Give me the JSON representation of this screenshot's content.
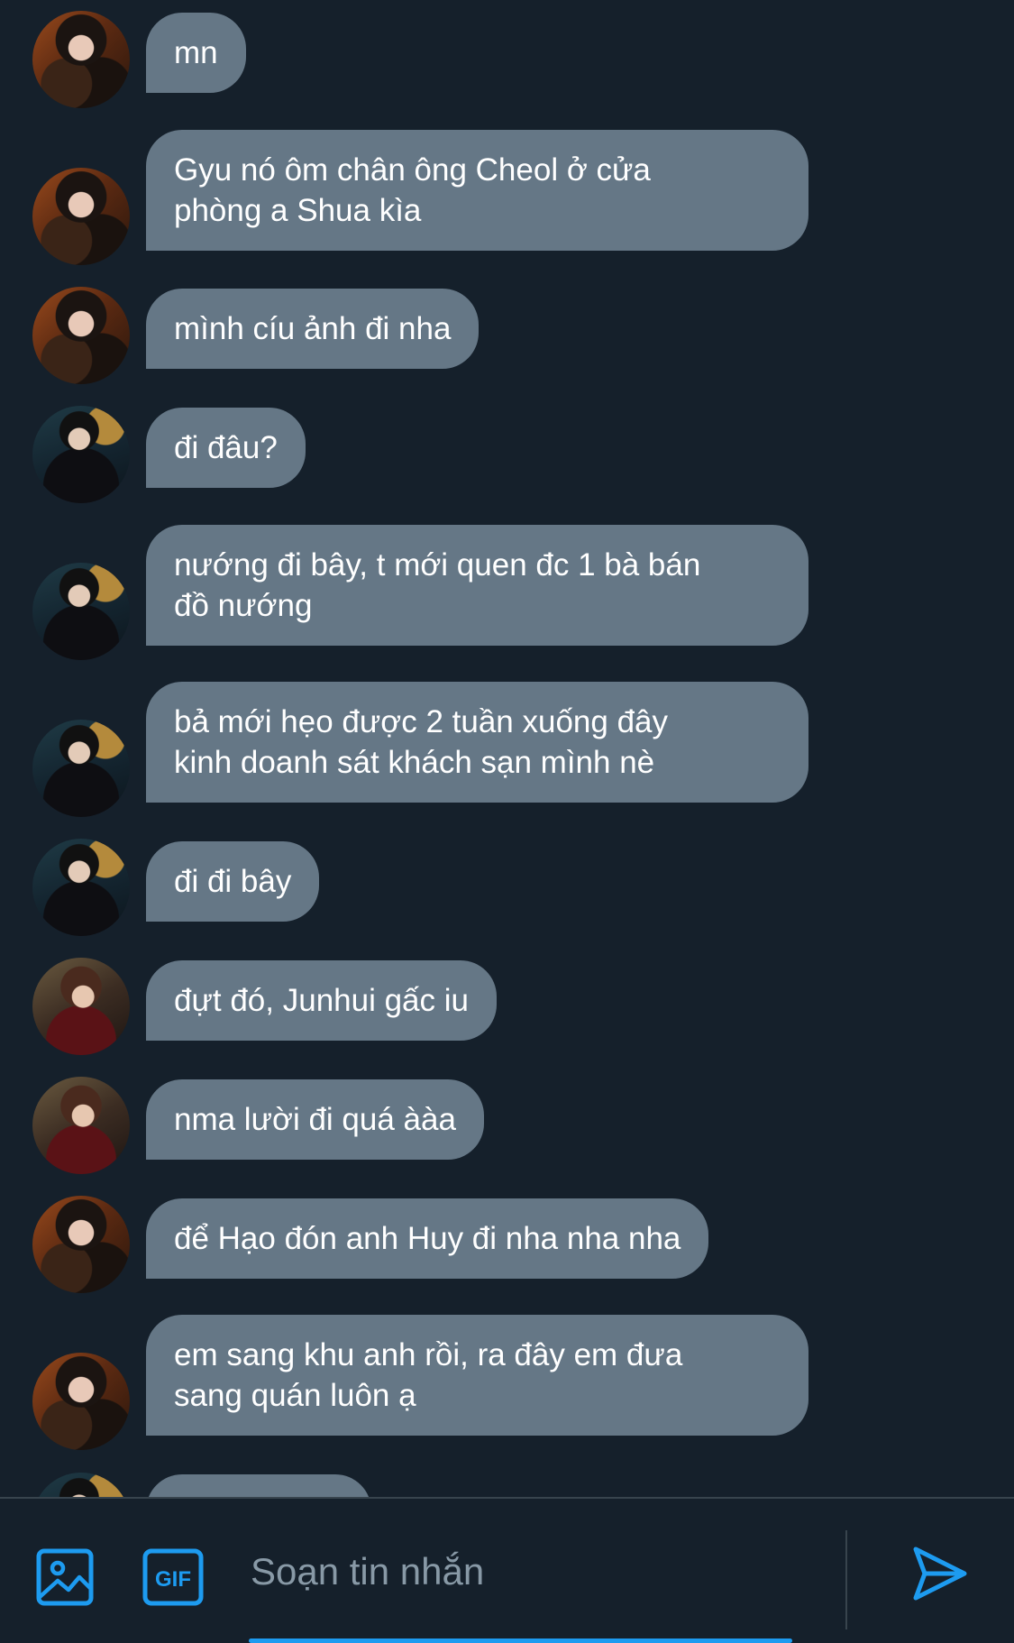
{
  "messages": [
    {
      "avatar": "a1",
      "text": "mn"
    },
    {
      "avatar": "a1",
      "text": "Gyu nó ôm chân ông Cheol ở cửa\nphòng a Shua kìa"
    },
    {
      "avatar": "a1",
      "text": "mình cíu ảnh đi nha"
    },
    {
      "avatar": "a2",
      "text": "đi đâu?"
    },
    {
      "avatar": "a2",
      "text": "nướng đi bây, t mới quen đc 1 bà bán\nđồ nướng"
    },
    {
      "avatar": "a2",
      "text": "bả mới hẹo được 2 tuần xuống đây\nkinh doanh sát khách sạn mình nè"
    },
    {
      "avatar": "a2",
      "text": "đi đi bây"
    },
    {
      "avatar": "a3",
      "text": "đựt đó, Junhui gấc iu"
    },
    {
      "avatar": "a3",
      "text": "nma lười đi quá ààa"
    },
    {
      "avatar": "a1",
      "text": "để Hạo đón anh Huy đi nha nha nha"
    },
    {
      "avatar": "a1",
      "text": "em sang khu anh rồi, ra đây em đưa\nsang quán luôn ạ"
    }
  ],
  "composer": {
    "placeholder": "Soạn tin nhắn",
    "gif_label": "GIF",
    "icons": {
      "media": "image-icon",
      "gif": "gif-icon",
      "send": "send-icon"
    }
  },
  "colors": {
    "background": "#15202b",
    "bubble": "#657786",
    "accent": "#1d9bf0",
    "divider": "#38444d"
  }
}
